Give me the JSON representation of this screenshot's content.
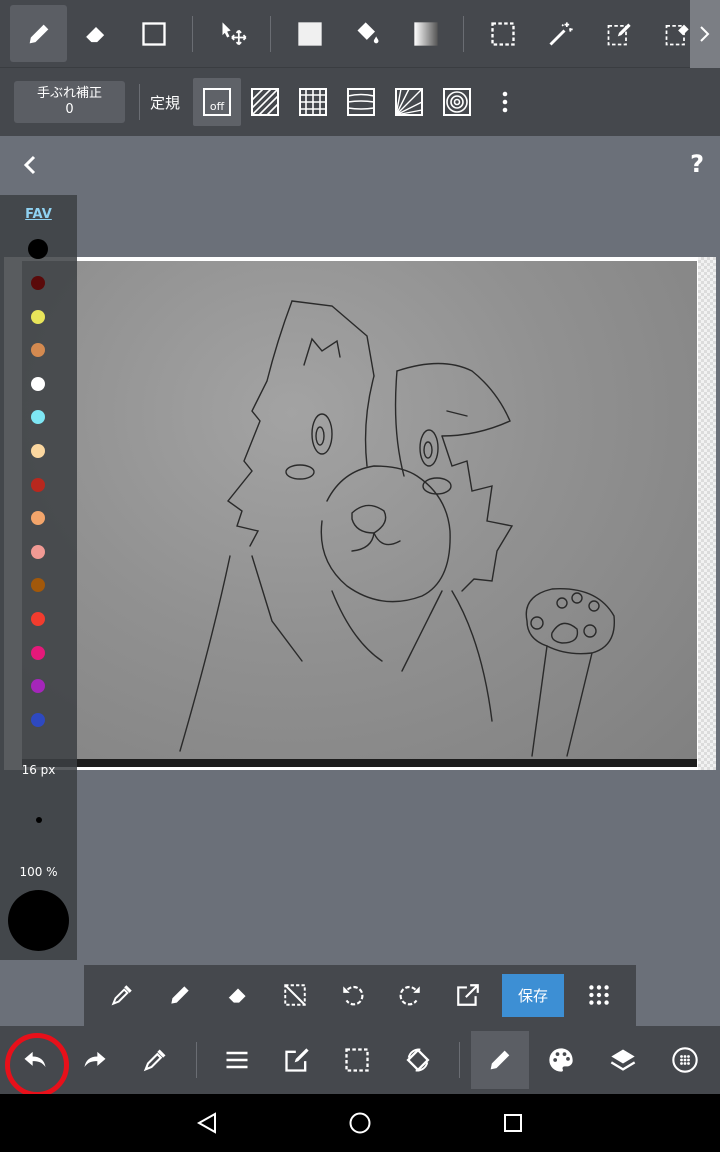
{
  "top_toolbar": {
    "tools": [
      {
        "icon": "pen-icon",
        "active": true
      },
      {
        "icon": "eraser-icon"
      },
      {
        "icon": "rectangle-shape-icon"
      },
      {
        "icon": "move-icon"
      },
      {
        "icon": "fill-square-icon"
      },
      {
        "icon": "bucket-icon"
      },
      {
        "icon": "gradient-icon"
      },
      {
        "icon": "select-rect-icon"
      },
      {
        "icon": "magic-wand-icon"
      },
      {
        "icon": "select-pen-icon"
      },
      {
        "icon": "select-eraser-icon"
      }
    ]
  },
  "second_toolbar": {
    "stabilizer_label": "手ぶれ補正",
    "stabilizer_value": "0",
    "ruler_label": "定規",
    "ruler_off_label": "off"
  },
  "color_panel": {
    "fav_label": "FAV",
    "swatches": [
      "#000000",
      "#5a0a0a",
      "#e8e55a",
      "#d48a50",
      "#ffffff",
      "#7ee6f4",
      "#fbd7a0",
      "#b8281e",
      "#f3a56b",
      "#f19a94",
      "#a2580a",
      "#f23c2e",
      "#e5197a",
      "#a526ba",
      "#2e49c0"
    ],
    "brush_size": "16 px",
    "opacity": "100 %",
    "current_color": "#000000"
  },
  "quick_bar": {
    "save_label": "保存"
  },
  "colors": {
    "toolbar_bg": "#45484d",
    "workspace_bg": "#6b7079",
    "accent_blue": "#3d8fd4",
    "highlight_ring": "#e8101a"
  }
}
